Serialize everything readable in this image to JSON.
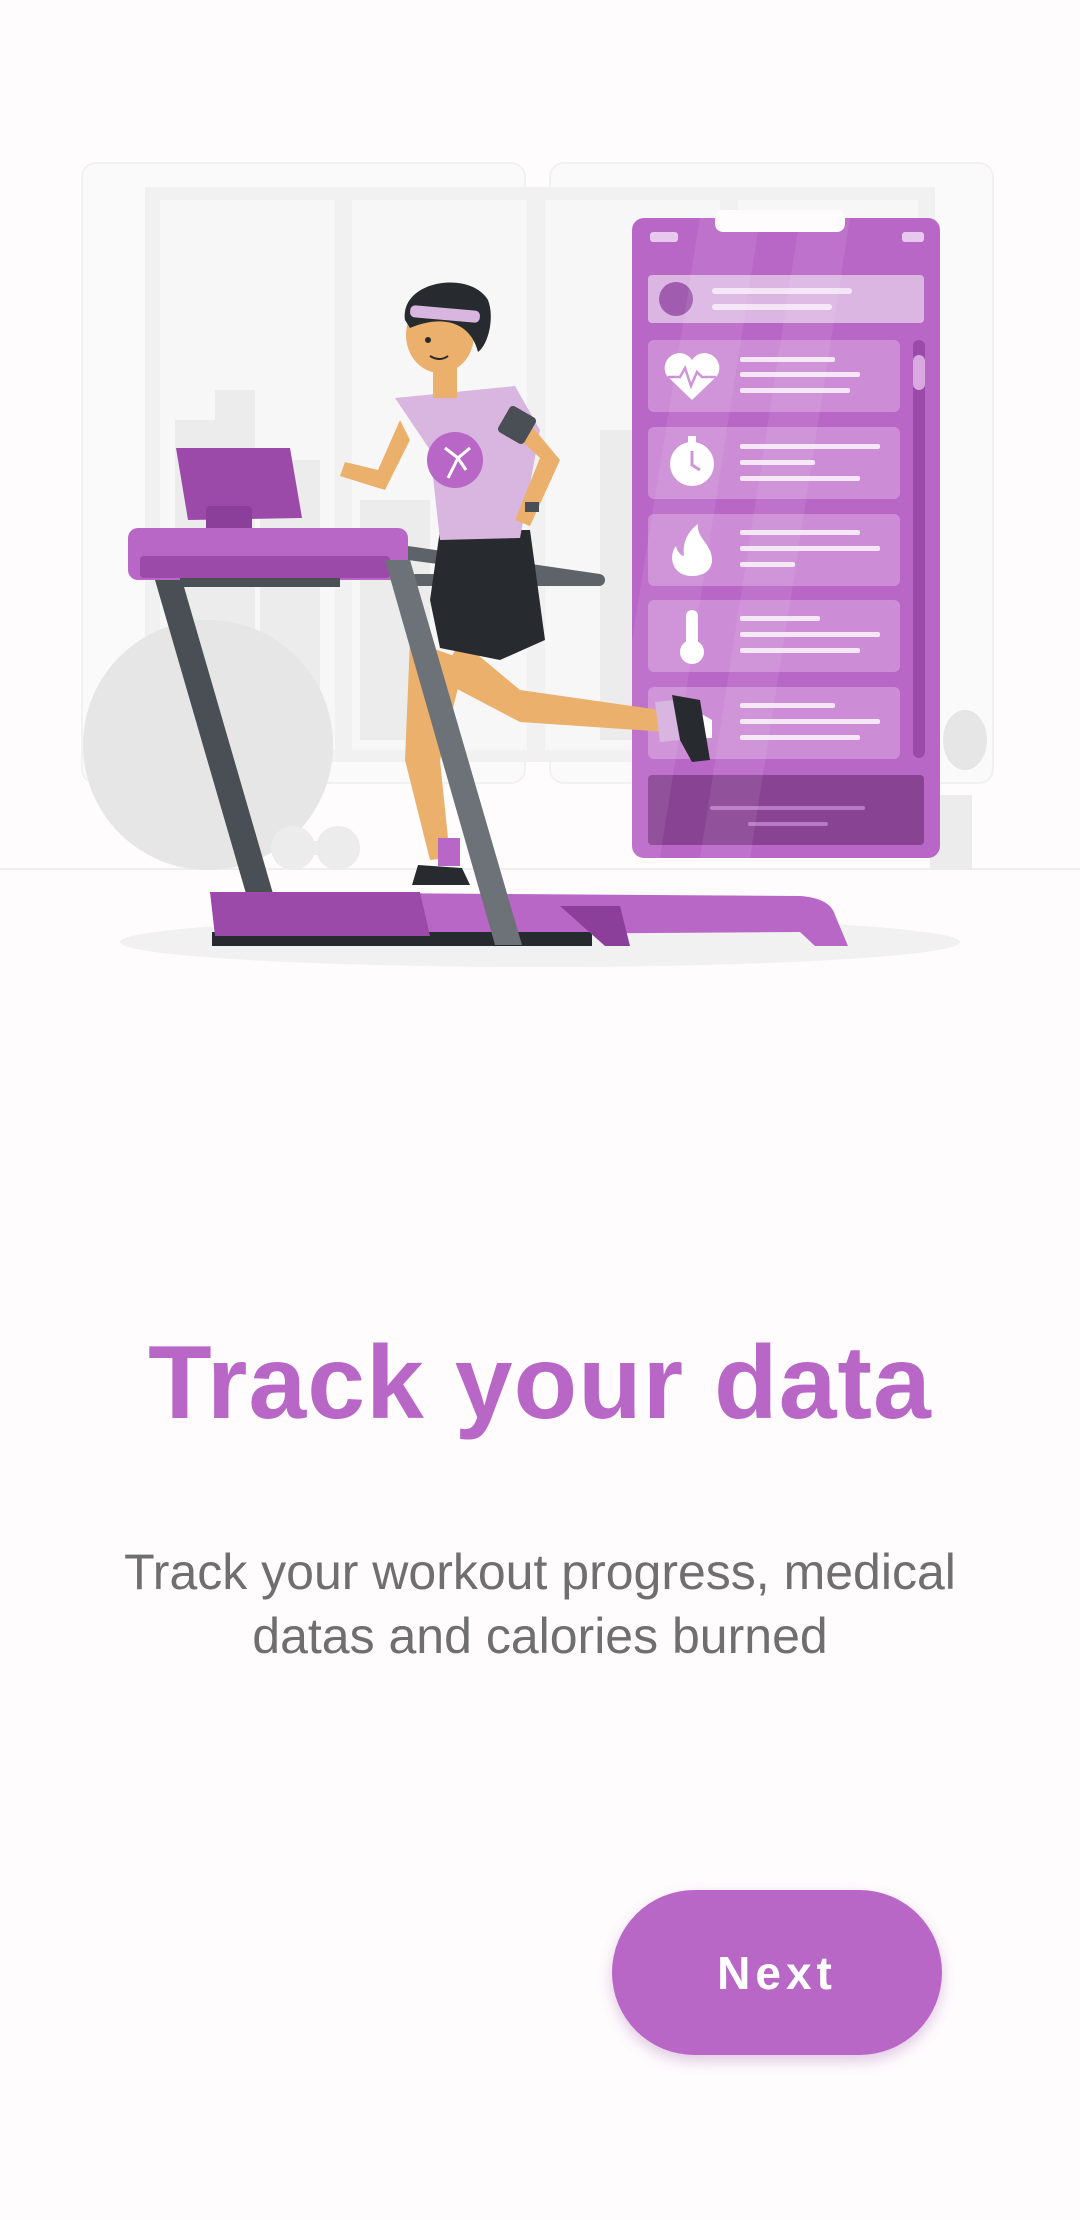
{
  "onboarding": {
    "title": "Track your data",
    "description": "Track your workout progress, medical datas and calories burned",
    "next_label": "Next"
  },
  "illustration": {
    "subject": "person running on treadmill next to phone showing health data",
    "phone_items": [
      "heart-icon",
      "stopwatch-icon",
      "flame-icon",
      "thermometer-icon",
      "shoe-icon"
    ]
  },
  "colors": {
    "accent": "#b967c7",
    "accent_dark": "#9b4aa9",
    "subtitle_text": "#6f6f6f",
    "background": "#fefcfd"
  }
}
